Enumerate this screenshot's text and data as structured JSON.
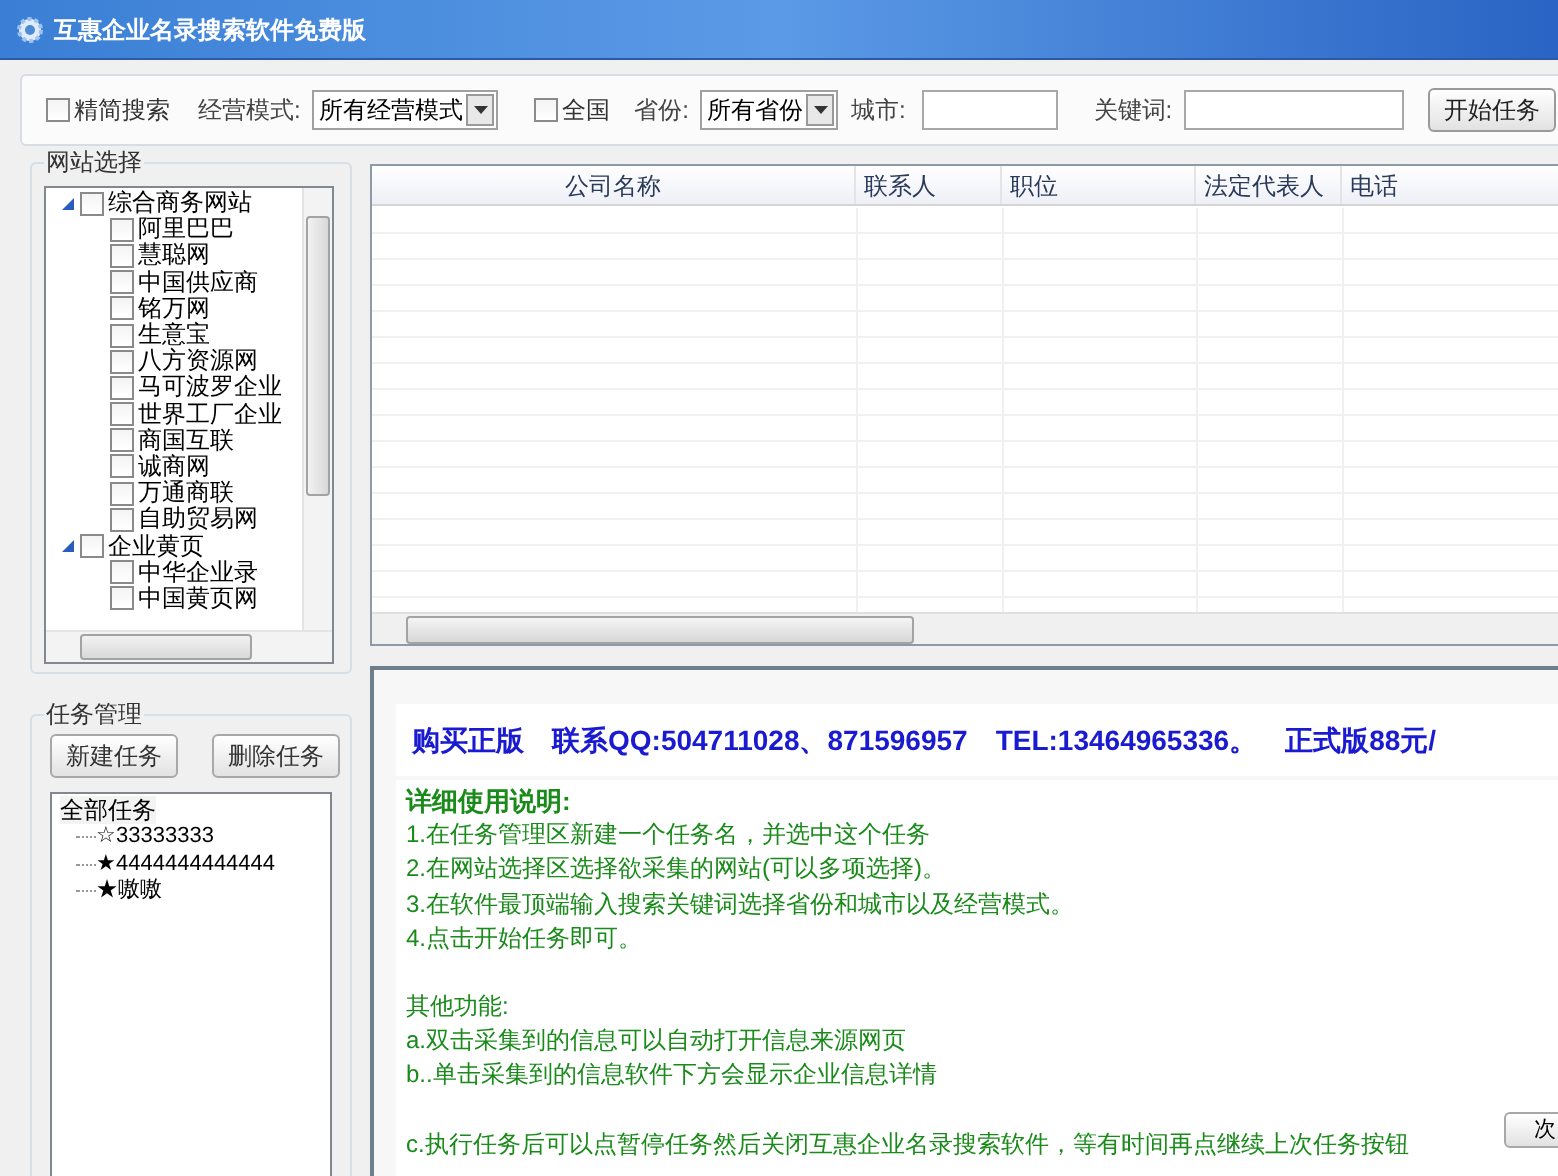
{
  "window": {
    "title": "互惠企业名录搜索软件免费版"
  },
  "toolbar": {
    "simple_search": {
      "label": "精简搜索",
      "checked": false
    },
    "mode_label": "经营模式:",
    "mode_value": "所有经营模式",
    "nationwide": {
      "label": "全国",
      "checked": false
    },
    "province_label": "省份:",
    "province_value": "所有省份",
    "city_label": "城市:",
    "keyword_label": "关键词:",
    "start_button": "开始任务"
  },
  "sites": {
    "title": "网站选择",
    "tree": [
      {
        "label": "综合商务网站",
        "checked": false,
        "expanded": true,
        "children": [
          {
            "label": "阿里巴巴",
            "checked": false
          },
          {
            "label": "慧聪网",
            "checked": false
          },
          {
            "label": "中国供应商",
            "checked": false
          },
          {
            "label": "铭万网",
            "checked": false
          },
          {
            "label": "生意宝",
            "checked": false
          },
          {
            "label": "八方资源网",
            "checked": false
          },
          {
            "label": "马可波罗企业",
            "checked": false
          },
          {
            "label": "世界工厂企业",
            "checked": false
          },
          {
            "label": "商国互联",
            "checked": false
          },
          {
            "label": "诚商网",
            "checked": false
          },
          {
            "label": "万通商联",
            "checked": false
          },
          {
            "label": "自助贸易网",
            "checked": false
          }
        ]
      },
      {
        "label": "企业黄页",
        "checked": false,
        "expanded": true,
        "children": [
          {
            "label": "中华企业录",
            "checked": false
          },
          {
            "label": "中国黄页网",
            "checked": false
          }
        ]
      }
    ]
  },
  "tasks": {
    "title": "任务管理",
    "new_button": "新建任务",
    "delete_button": "删除任务",
    "tree": {
      "label": "全部任务",
      "selected": true,
      "children": [
        {
          "label": "☆33333333",
          "selected": false
        },
        {
          "label": "★4444444444444",
          "selected": false
        },
        {
          "label": "★嗷嗷",
          "selected": false
        }
      ]
    }
  },
  "table": {
    "columns": [
      "公司名称",
      "联系人",
      "职位",
      "法定代表人",
      "电话"
    ]
  },
  "info": {
    "banner": "购买正版　联系QQ:504711028、871596957　TEL:13464965336。　正式版88元/",
    "heading": "详细使用说明:",
    "steps": [
      "1.在任务管理区新建一个任务名，并选中这个任务",
      "2.在网站选择区选择欲采集的网站(可以多项选择)。",
      "3.在软件最顶端输入搜索关键词选择省份和城市以及经营模式。",
      "4.点击开始任务即可。"
    ],
    "other_heading": "其他功能:",
    "other": [
      "a.双击采集到的信息可以自动打开信息来源网页",
      "b..单击采集到的信息软件下方会显示企业信息详情"
    ],
    "extra": "c.执行任务后可以点暂停任务然后关闭互惠企业名录搜索软件，等有时间再点继续上次任务按钮"
  },
  "corner_button": "次"
}
